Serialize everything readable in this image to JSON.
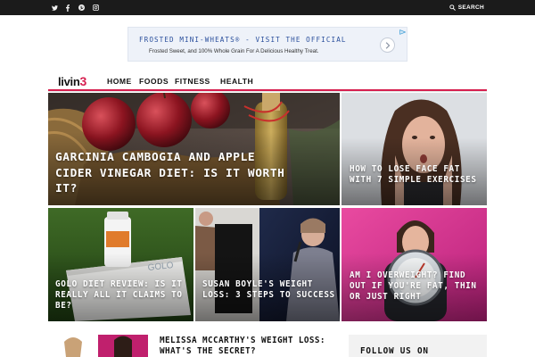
{
  "topbar": {
    "social_icons": [
      "twitter-icon",
      "facebook-icon",
      "pinterest-icon",
      "instagram-icon"
    ],
    "search_label": "SEARCH"
  },
  "ad": {
    "title": "FROSTED MINI-WHEATS® - VISIT THE OFFICIAL",
    "description": "Frosted Sweet, and 100% Whole Grain For A Delicious Healthy Treat."
  },
  "header": {
    "logo_text": "livin",
    "logo_accent": "3",
    "nav": [
      "HOME",
      "FOODS",
      "FITNESS",
      "HEALTH"
    ]
  },
  "tiles": {
    "garcinia": "GARCINIA CAMBOGIA AND APPLE CIDER VINEGAR DIET: IS IT WORTH IT?",
    "face_fat": "HOW TO LOSE FACE FAT WITH 7 SIMPLE EXERCISES",
    "golo": "GOLO DIET REVIEW: IS IT REALLY ALL IT CLAIMS TO BE?",
    "susan": "SUSAN BOYLE'S WEIGHT LOSS: 3 STEPS TO SUCCESS",
    "overweight": "AM I OVERWEIGHT? FIND OUT IF YOU'RE FAT, THIN OR JUST RIGHT"
  },
  "bottom": {
    "article_title": "MELISSA MCCARTHY'S WEIGHT LOSS: WHAT'S THE SECRET?",
    "follow_title": "FOLLOW US ON"
  },
  "colors": {
    "accent": "#d61f4f",
    "topbar_bg": "#1b1b1b",
    "ad_link": "#2a4f9c"
  }
}
